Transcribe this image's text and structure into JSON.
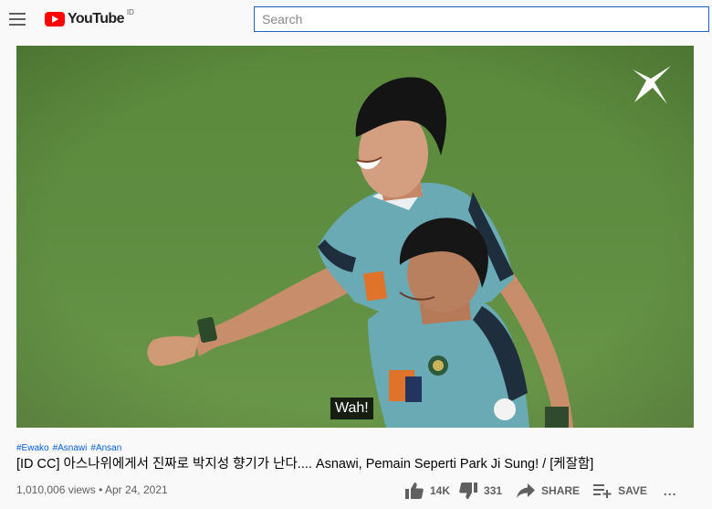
{
  "header": {
    "logo_text": "YouTube",
    "region": "ID",
    "search_placeholder": "Search"
  },
  "player": {
    "caption": "Wah!",
    "channel_watermark": "K-League logo"
  },
  "video": {
    "hashtags": [
      "#Ewako",
      "#Asnawi",
      "#Ansan"
    ],
    "title": "[ID CC] 아스나위에게서 진짜로 박지성 향기가 난다.... Asnawi, Pemain Seperti Park Ji Sung! / [케잘함]",
    "views": "1,010,006 views",
    "separator": "•",
    "date": "Apr 24, 2021"
  },
  "actions": {
    "likes": "14K",
    "dislikes": "331",
    "share_label": "SHARE",
    "save_label": "SAVE",
    "more_label": "..."
  },
  "colors": {
    "brand_red": "#ff0000",
    "link_blue": "#065fd4",
    "search_border": "#1c62b9",
    "pitch_green": "#5c8a3f",
    "jersey_teal": "#6aaab5"
  }
}
